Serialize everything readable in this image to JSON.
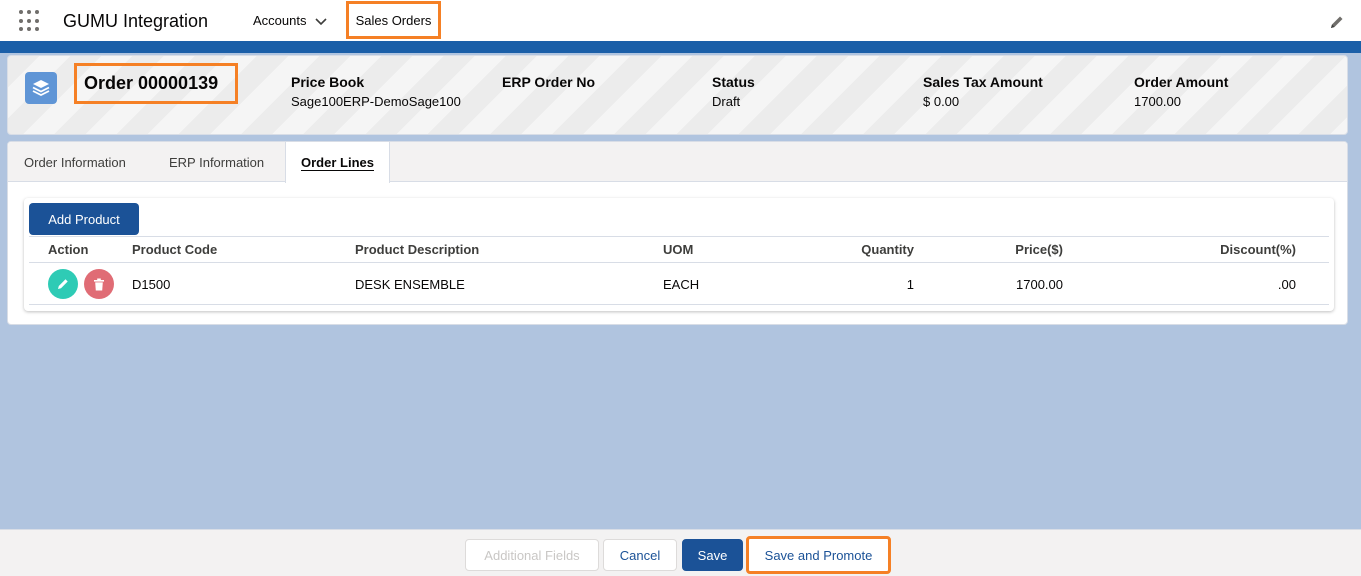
{
  "topnav": {
    "app_name": "GUMU Integration",
    "accounts_label": "Accounts",
    "sales_orders_label": "Sales Orders"
  },
  "header": {
    "title": "Order 00000139",
    "fields": [
      {
        "label": "Price Book",
        "value": "Sage100ERP-DemoSage100"
      },
      {
        "label": "ERP Order No",
        "value": ""
      },
      {
        "label": "Status",
        "value": "Draft"
      },
      {
        "label": "Sales Tax Amount",
        "value": "$ 0.00"
      },
      {
        "label": "Order Amount",
        "value": "1700.00"
      }
    ]
  },
  "tabs": [
    {
      "label": "Order Information"
    },
    {
      "label": "ERP Information"
    },
    {
      "label": "Order Lines",
      "active": true
    }
  ],
  "order_lines": {
    "add_button": "Add Product",
    "columns": [
      "Action",
      "Product Code",
      "Product Description",
      "UOM",
      "Quantity",
      "Price($)",
      "Discount(%)"
    ],
    "rows": [
      {
        "product_code": "D1500",
        "description": "DESK ENSEMBLE",
        "uom": "EACH",
        "quantity": "1",
        "price": "1700.00",
        "discount": ".00"
      }
    ]
  },
  "footer": {
    "additional_fields": "Additional Fields",
    "cancel": "Cancel",
    "save": "Save",
    "save_promote": "Save and Promote"
  },
  "colors": {
    "brand": "#1b5297",
    "highlight": "#f58025",
    "edit_action": "#2ecbb5",
    "delete_action": "#e06c75",
    "page_bg": "#b0c4df"
  },
  "icons": [
    "app-launcher-icon",
    "chevron-down-icon",
    "pencil-icon",
    "layers-icon",
    "edit-icon",
    "trash-icon"
  ]
}
